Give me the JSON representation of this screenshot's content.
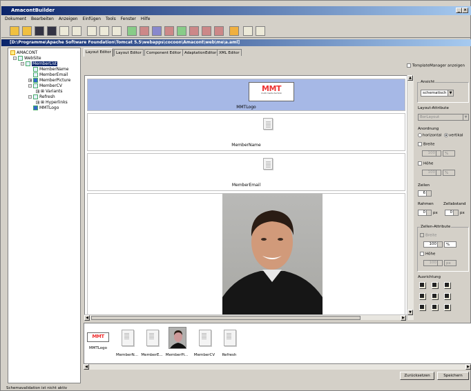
{
  "app": {
    "title": "AmacontBuilder"
  },
  "menu": [
    "Dokument",
    "Bearbeiten",
    "Anzeigen",
    "Einfügen",
    "Tools",
    "Fenster",
    "Hilfe"
  ],
  "document": {
    "path": "[D:\\Programme\\Apache Software Foundation\\Tomcat 5.5\\webapps\\cocoon\\Amacont\\web\\me\\a.aml]"
  },
  "tree": {
    "nodes": [
      "AMACONT",
      "WebSite",
      "MemberList",
      "MemberName",
      "MemberEmail",
      "MemberPicture",
      "MemberCV",
      "Variants",
      "Refresh",
      "Hyperlinks",
      "MMTLogo"
    ]
  },
  "tabs": [
    "Layout Editor",
    "Layout Editor",
    "Component Editor",
    "AdaptationEditor",
    "XML Editor"
  ],
  "template_manager_label": "TemplateManager anzeigen",
  "canvas": {
    "logo_text": "MMT",
    "logo_sub": "multi media technik",
    "cells": [
      "MMTLogo",
      "MemberName",
      "MemberEmail"
    ]
  },
  "props": {
    "ansicht_title": "Ansicht",
    "ansicht_value": "schematisch",
    "layout_attr_title": "Layout-Attribute",
    "layout_attr_value": "BorLayout",
    "anordnung_title": "Anordnung",
    "horizontal": "horizontal",
    "vertikal": "vertikal",
    "breite": "Breite",
    "breite_value": "100",
    "breite_unit": "%",
    "hoehe": "Höhe",
    "hoehe_value": "100",
    "hoehe_unit": "%",
    "zeilen": "Zeilen",
    "zeilen_value": "6",
    "rahmen": "Rahmen",
    "rahmen_value": "0",
    "px": "px",
    "zellabstand": "Zellabstand",
    "zellabstand_value": "0",
    "zellen_attr_title": "Zellen-Attribute",
    "zellen_breite": "Breite",
    "zellen_breite_value": "100",
    "zellen_breite_unit": "%",
    "zellen_hoehe": "Höhe",
    "zellen_hoehe_value": "100",
    "zellen_hoehe_unit": "px",
    "ausrichtung_title": "Ausrichtung"
  },
  "tray": {
    "items": [
      "MMTLogo",
      "MemberN...",
      "MemberE...",
      "MemberPi...",
      "MemberCV",
      "Refresh"
    ]
  },
  "buttons": {
    "reset": "Zurücksetzen",
    "save": "Speichern"
  },
  "status": "Schemavalidation ist nicht aktiv"
}
